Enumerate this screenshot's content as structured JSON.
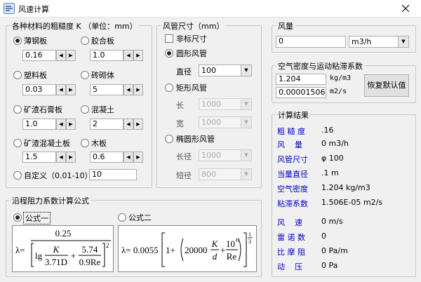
{
  "window": {
    "title": "风速计算"
  },
  "roughness": {
    "title": "各种材料的粗糙度 K （单位：mm）",
    "materials": [
      {
        "label": "薄钢板",
        "value": "0.16",
        "selected": true
      },
      {
        "label": "胶合板",
        "value": "1.0",
        "selected": false
      },
      {
        "label": "塑料板",
        "value": "0.03",
        "selected": false
      },
      {
        "label": "砖砌体",
        "value": "5",
        "selected": false
      },
      {
        "label": "矿渣石膏板",
        "value": "1.0",
        "selected": false
      },
      {
        "label": "混凝土",
        "value": "2",
        "selected": false
      },
      {
        "label": "矿渣混凝土板",
        "value": "1.5",
        "selected": false
      },
      {
        "label": "木板",
        "value": "0.6",
        "selected": false
      }
    ],
    "custom": {
      "label": "自定义（0.01-10）",
      "value": "10"
    }
  },
  "duct": {
    "title": "风管尺寸（mm）",
    "nonstandard": "非标尺寸",
    "round": {
      "label": "圆形风管",
      "diameter_label": "直径",
      "diameter": "100"
    },
    "rect": {
      "label": "矩形风管",
      "length_label": "长",
      "length": "1000",
      "width_label": "宽",
      "width": "1000"
    },
    "oval": {
      "label": "椭圆形风管",
      "long_label": "长径",
      "long": "1000",
      "short_label": "短径",
      "short": "800"
    }
  },
  "flow": {
    "title": "风量",
    "value": "0",
    "unit": "m3/h"
  },
  "air": {
    "title": "空气密度与运动粘滞系数",
    "density": "1.204",
    "density_unit": "kg/m3",
    "viscosity": "0.00001506",
    "viscosity_unit": "m2/s",
    "reset_label": "恢复默认值"
  },
  "results": {
    "title": "计算结果",
    "items": [
      {
        "label": "粗 糙 度",
        "value": ".16"
      },
      {
        "label": "风    量",
        "value": "0 m3/h"
      },
      {
        "label": "风管尺寸",
        "value": "φ 100"
      },
      {
        "label": "当量直径",
        "value": ".1 m"
      },
      {
        "label": "空气密度",
        "value": "1.204 kg/m3"
      },
      {
        "label": "粘滞系数",
        "value": "1.506E-05 m2/s"
      },
      {
        "label": "风    速",
        "value": "0 m/s"
      },
      {
        "label": "雷 诺 数",
        "value": "0"
      },
      {
        "label": "比 摩 阻",
        "value": "0 Pa/m"
      },
      {
        "label": "动    压",
        "value": "0 Pa"
      }
    ]
  },
  "formula": {
    "title": "沿程阻力系数计算公式",
    "option1": "公式一",
    "option2": "公式二",
    "f1": {
      "lambda": "λ=",
      "num": "0.25",
      "lg": "lg",
      "K": "K",
      "d1": "3.71D",
      "plus": "+",
      "n2": "5.74",
      "d2": "0.9Re",
      "exp": "2"
    },
    "f2": {
      "lambda": "λ= 0.0055",
      "one": "1+",
      "k20": "20000",
      "K": "K",
      "d": "d",
      "plus": "+",
      "n6": "10",
      "e6": "6",
      "Re": "Re",
      "root_n": "1",
      "root_d": "3"
    }
  }
}
